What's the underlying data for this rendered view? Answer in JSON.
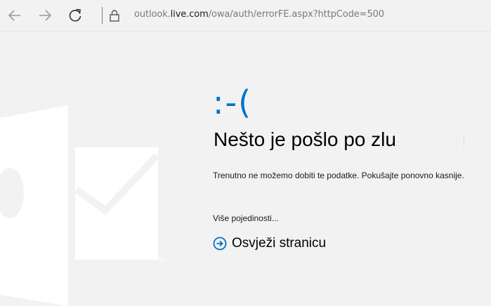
{
  "browser": {
    "back_icon": "arrow-left-icon",
    "forward_icon": "arrow-right-icon",
    "refresh_icon": "refresh-icon",
    "lock_icon": "lock-icon",
    "url_prefix": "outlook.",
    "url_domain": "live.com",
    "url_path": "/owa/auth/errorFE.aspx?httpCode=500"
  },
  "error": {
    "emoticon": ":-(",
    "headline": "Nešto je pošlo po zlu",
    "message": "Trenutno ne možemo dobiti te podatke. Pokušajte ponovno kasnije.",
    "more_details": "Više pojedinosti...",
    "refresh_label": "Osvježi stranicu",
    "refresh_icon": "circle-arrow-right-icon"
  },
  "colors": {
    "accent": "#0072c6",
    "background": "#f2f2f2",
    "logo_watermark": "#ffffff"
  }
}
